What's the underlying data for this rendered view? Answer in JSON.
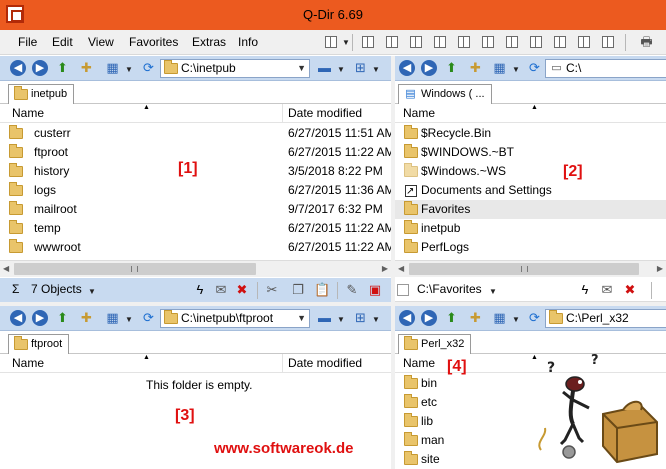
{
  "window": {
    "title": "Q-Dir 6.69"
  },
  "menu": [
    "File",
    "Edit",
    "View",
    "Favorites",
    "Extras",
    "Info"
  ],
  "columns": {
    "name": "Name",
    "date": "Date modified"
  },
  "pane1": {
    "path": "C:\\inetpub",
    "tab": "inetpub",
    "marker": "[1]",
    "rows": [
      {
        "name": "custerr",
        "date": "6/27/2015 11:51 AM"
      },
      {
        "name": "ftproot",
        "date": "6/27/2015 11:22 AM"
      },
      {
        "name": "history",
        "date": "3/5/2018 8:22 PM"
      },
      {
        "name": "logs",
        "date": "6/27/2015 11:36 AM"
      },
      {
        "name": "mailroot",
        "date": "9/7/2017 6:32 PM"
      },
      {
        "name": "temp",
        "date": "6/27/2015 11:22 AM"
      },
      {
        "name": "wwwroot",
        "date": "6/27/2015 11:22 AM"
      }
    ],
    "status": "7 Objects"
  },
  "pane2": {
    "path": "C:\\",
    "tab": "Windows ( ...",
    "marker": "[2]",
    "rows": [
      {
        "name": "$Recycle.Bin",
        "icon": "folder"
      },
      {
        "name": "$WINDOWS.~BT",
        "icon": "folder"
      },
      {
        "name": "$Windows.~WS",
        "icon": "folder"
      },
      {
        "name": "Documents and Settings",
        "icon": "shortcut"
      },
      {
        "name": "Favorites",
        "icon": "folder",
        "selected": true
      },
      {
        "name": "inetpub",
        "icon": "folder"
      },
      {
        "name": "PerfLogs",
        "icon": "folder"
      }
    ],
    "status": "C:\\Favorites"
  },
  "pane3": {
    "path": "C:\\inetpub\\ftproot",
    "tab": "ftproot",
    "marker": "[3]",
    "empty_message": "This folder is empty."
  },
  "pane4": {
    "path": "C:\\Perl_x32",
    "tab": "Perl_x32",
    "marker": "[4]",
    "rows": [
      {
        "name": "bin"
      },
      {
        "name": "etc"
      },
      {
        "name": "lib"
      },
      {
        "name": "man"
      },
      {
        "name": "site"
      }
    ]
  },
  "watermark": "www.softwareok.de",
  "colors": {
    "titlebar": "#ec5a1f",
    "addressbar": "#c8daf0",
    "marker": "#e01010"
  }
}
